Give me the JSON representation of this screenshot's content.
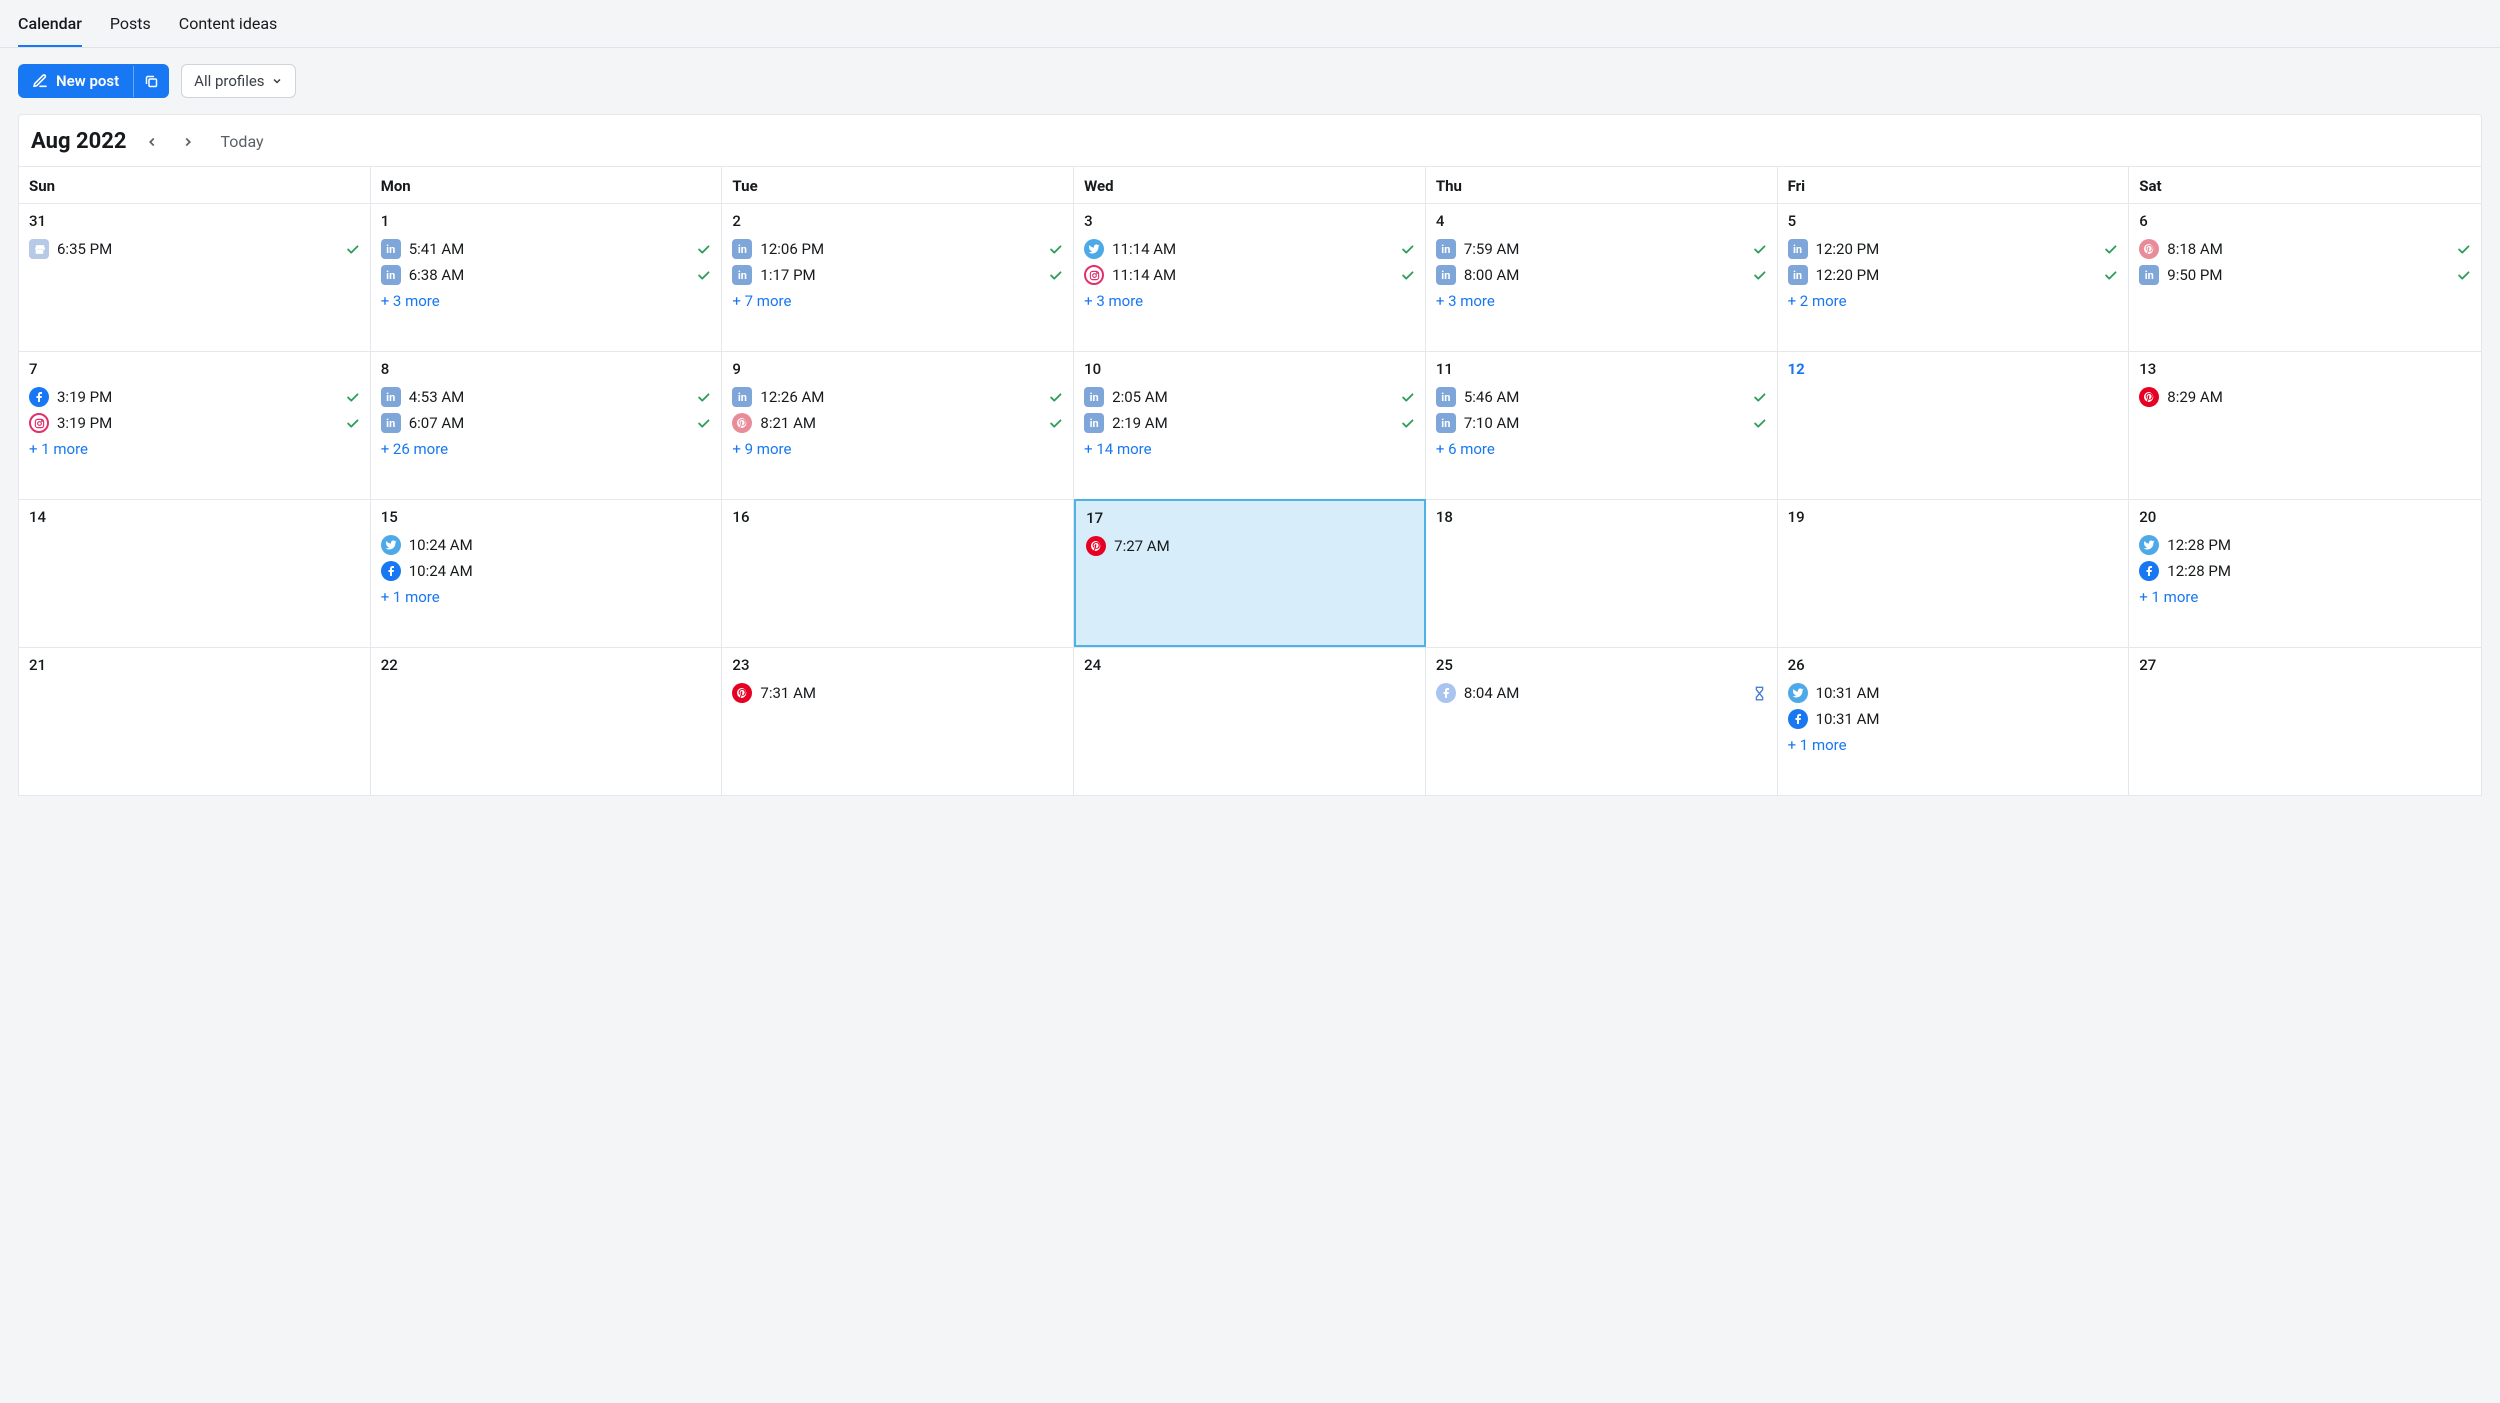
{
  "tabs": {
    "calendar": "Calendar",
    "posts": "Posts",
    "ideas": "Content ideas"
  },
  "toolbar": {
    "new_post": "New post",
    "profiles": "All profiles"
  },
  "header": {
    "month": "Aug 2022",
    "today": "Today"
  },
  "dow": [
    "Sun",
    "Mon",
    "Tue",
    "Wed",
    "Thu",
    "Fri",
    "Sat"
  ],
  "more_prefix": "+ ",
  "more_suffix": " more",
  "weeks": [
    [
      {
        "n": "31",
        "posts": [
          {
            "net": "gmb",
            "t": "6:35 PM",
            "s": "done"
          }
        ]
      },
      {
        "n": "1",
        "posts": [
          {
            "net": "linkedin",
            "t": "5:41 AM",
            "s": "done"
          },
          {
            "net": "linkedin",
            "t": "6:38 AM",
            "s": "done"
          }
        ],
        "more": 3
      },
      {
        "n": "2",
        "posts": [
          {
            "net": "linkedin",
            "t": "12:06 PM",
            "s": "done"
          },
          {
            "net": "linkedin",
            "t": "1:17 PM",
            "s": "done"
          }
        ],
        "more": 7
      },
      {
        "n": "3",
        "posts": [
          {
            "net": "twitter",
            "t": "11:14 AM",
            "s": "done"
          },
          {
            "net": "instagram",
            "t": "11:14 AM",
            "s": "done"
          }
        ],
        "more": 3
      },
      {
        "n": "4",
        "posts": [
          {
            "net": "linkedin",
            "t": "7:59 AM",
            "s": "done"
          },
          {
            "net": "linkedin",
            "t": "8:00 AM",
            "s": "done"
          }
        ],
        "more": 3
      },
      {
        "n": "5",
        "posts": [
          {
            "net": "linkedin",
            "t": "12:20 PM",
            "s": "done"
          },
          {
            "net": "linkedin",
            "t": "12:20 PM",
            "s": "done"
          }
        ],
        "more": 2
      },
      {
        "n": "6",
        "posts": [
          {
            "net": "pinterest-pale",
            "t": "8:18 AM",
            "s": "done"
          },
          {
            "net": "linkedin",
            "t": "9:50 PM",
            "s": "done"
          }
        ]
      }
    ],
    [
      {
        "n": "7",
        "posts": [
          {
            "net": "facebook",
            "t": "3:19 PM",
            "s": "done"
          },
          {
            "net": "instagram",
            "t": "3:19 PM",
            "s": "done"
          }
        ],
        "more": 1
      },
      {
        "n": "8",
        "posts": [
          {
            "net": "linkedin",
            "t": "4:53 AM",
            "s": "done"
          },
          {
            "net": "linkedin",
            "t": "6:07 AM",
            "s": "done"
          }
        ],
        "more": 26
      },
      {
        "n": "9",
        "posts": [
          {
            "net": "linkedin",
            "t": "12:26 AM",
            "s": "done"
          },
          {
            "net": "pinterest-pale",
            "t": "8:21 AM",
            "s": "done"
          }
        ],
        "more": 9
      },
      {
        "n": "10",
        "posts": [
          {
            "net": "linkedin",
            "t": "2:05 AM",
            "s": "done"
          },
          {
            "net": "linkedin",
            "t": "2:19 AM",
            "s": "done"
          }
        ],
        "more": 14
      },
      {
        "n": "11",
        "posts": [
          {
            "net": "linkedin",
            "t": "5:46 AM",
            "s": "done"
          },
          {
            "net": "linkedin",
            "t": "7:10 AM",
            "s": "done"
          }
        ],
        "more": 6
      },
      {
        "n": "12",
        "accent": true,
        "posts": []
      },
      {
        "n": "13",
        "posts": [
          {
            "net": "pinterest",
            "t": "8:29 AM"
          }
        ]
      }
    ],
    [
      {
        "n": "14",
        "posts": []
      },
      {
        "n": "15",
        "posts": [
          {
            "net": "twitter",
            "t": "10:24 AM"
          },
          {
            "net": "facebook",
            "t": "10:24 AM"
          }
        ],
        "more": 1
      },
      {
        "n": "16",
        "posts": []
      },
      {
        "n": "17",
        "today": true,
        "posts": [
          {
            "net": "pinterest",
            "t": "7:27 AM"
          }
        ]
      },
      {
        "n": "18",
        "posts": []
      },
      {
        "n": "19",
        "posts": []
      },
      {
        "n": "20",
        "posts": [
          {
            "net": "twitter",
            "t": "12:28 PM"
          },
          {
            "net": "facebook",
            "t": "12:28 PM"
          }
        ],
        "more": 1
      }
    ],
    [
      {
        "n": "21",
        "posts": []
      },
      {
        "n": "22",
        "posts": []
      },
      {
        "n": "23",
        "posts": [
          {
            "net": "pinterest",
            "t": "7:31 AM"
          }
        ]
      },
      {
        "n": "24",
        "posts": []
      },
      {
        "n": "25",
        "posts": [
          {
            "net": "facebook-pale",
            "t": "8:04 AM",
            "s": "pending"
          }
        ]
      },
      {
        "n": "26",
        "posts": [
          {
            "net": "twitter",
            "t": "10:31 AM"
          },
          {
            "net": "facebook",
            "t": "10:31 AM"
          }
        ],
        "more": 1
      },
      {
        "n": "27",
        "posts": []
      }
    ]
  ]
}
